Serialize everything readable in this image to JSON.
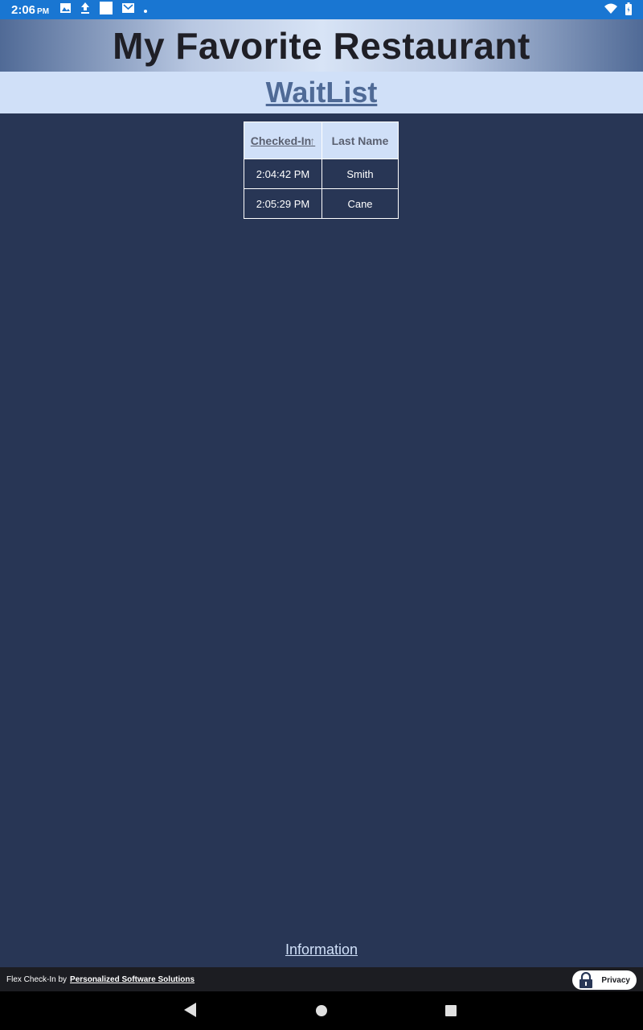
{
  "status_bar": {
    "time": "2:06",
    "ampm": "PM",
    "icons": [
      "image-icon",
      "upload-icon",
      "square-icon",
      "mail-icon",
      "dot-icon",
      "wifi-icon",
      "battery-icon"
    ]
  },
  "header": {
    "title": "My Favorite Restaurant"
  },
  "subheader": {
    "link": "WaitList"
  },
  "table": {
    "columns": [
      "Checked-In",
      "Last Name"
    ],
    "rows": [
      {
        "time": "2:04:42 PM",
        "name": "Smith"
      },
      {
        "time": "2:05:29 PM",
        "name": "Cane"
      }
    ]
  },
  "information_link": "Information",
  "footer": {
    "credit_prefix": "Flex Check-In by",
    "credit_link": "Personalized Software Solutions",
    "privacy": "Privacy"
  },
  "colors": {
    "background": "#283655",
    "status_bar": "#1976d2",
    "header_light": "#d0e0f8",
    "accent_text": "#4f6a96"
  }
}
